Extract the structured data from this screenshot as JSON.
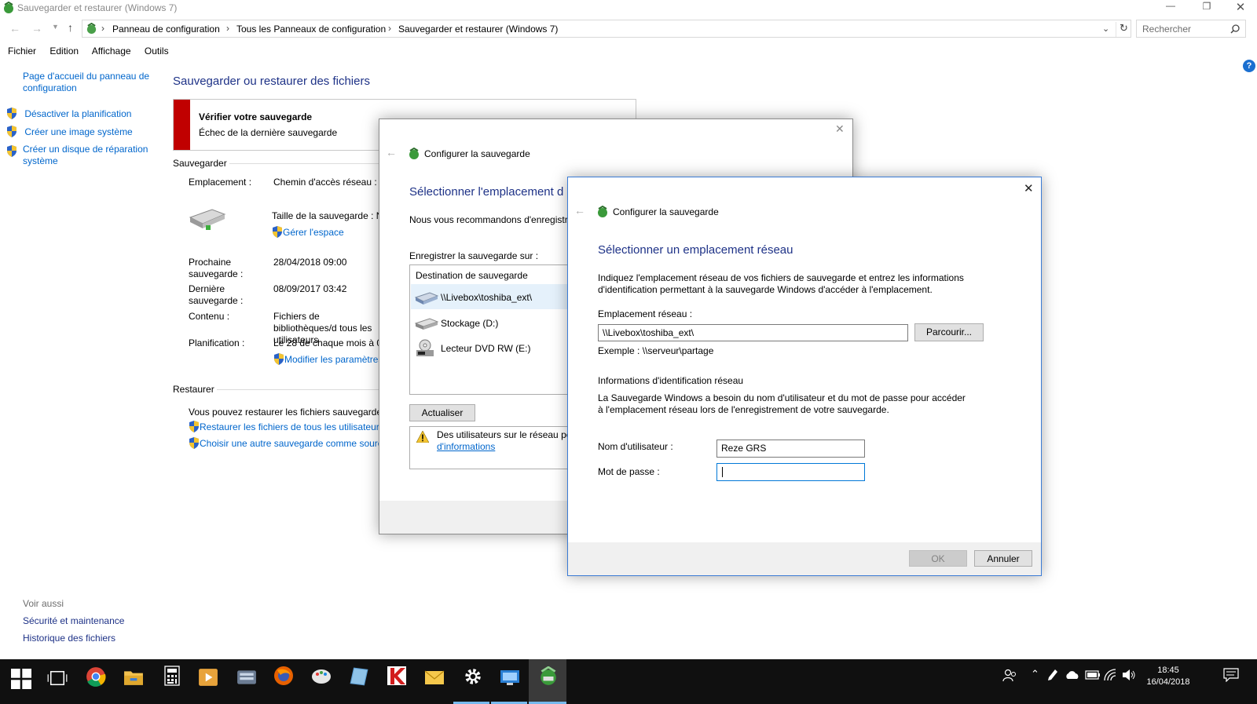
{
  "window": {
    "title": "Sauvegarder et restaurer (Windows 7)"
  },
  "address": {
    "crumbs": [
      "Panneau de configuration",
      "Tous les Panneaux de configuration",
      "Sauvegarder et restaurer (Windows 7)"
    ],
    "search_placeholder": "Rechercher"
  },
  "menu": [
    "Fichier",
    "Edition",
    "Affichage",
    "Outils"
  ],
  "sidebar": {
    "home": "Page d'accueil du panneau de configuration",
    "items": [
      "Désactiver la planification",
      "Créer une image système",
      "Créer un disque de réparation système"
    ],
    "see_also_title": "Voir aussi",
    "see_also": [
      "Sécurité et maintenance",
      "Historique des fichiers"
    ]
  },
  "main": {
    "title": "Sauvegarder ou restaurer des fichiers",
    "alert_title": "Vérifier votre sauvegarde",
    "alert_sub": "Échec de la dernière sauvegarde",
    "backup_section": "Sauvegarder",
    "location_label": "Emplacement :",
    "location_value": "Chemin d'accès réseau : \\\\",
    "size_label": "Taille de la sauvegarde : No",
    "manage_space": "Gérer l'espace",
    "next_label": "Prochaine sauvegarde :",
    "next_value": "28/04/2018 09:00",
    "last_label": "Dernière sauvegarde :",
    "last_value": "08/09/2017 03:42",
    "content_label": "Contenu :",
    "content_value": "Fichiers de bibliothèques/d tous les utilisateurs",
    "schedule_label": "Planification :",
    "schedule_value": "Le 28 de chaque mois à 09",
    "modify_settings": "Modifier les paramètres",
    "restore_section": "Restaurer",
    "restore_text": "Vous pouvez restaurer les fichiers sauvegardés à",
    "restore_all": "Restaurer les fichiers de tous les utilisateurs",
    "choose_other": "Choisir une autre sauvegarde comme source"
  },
  "dialog1": {
    "title": "Configurer la sauvegarde",
    "heading": "Sélectionner l'emplacement d",
    "recommend": "Nous vous recommandons d'enregistre",
    "save_on": "Enregistrer la sauvegarde sur :",
    "list_header": "Destination de sauvegarde",
    "destinations": [
      "\\\\Livebox\\toshiba_ext\\",
      "Stockage (D:)",
      "Lecteur DVD RW (E:)"
    ],
    "refresh": "Actualiser",
    "warning": "Des utilisateurs sur le réseau peu",
    "warning_link": "d'informations"
  },
  "dialog2": {
    "title": "Configurer la sauvegarde",
    "heading": "Sélectionner un emplacement réseau",
    "intro": "Indiquez l'emplacement réseau de vos fichiers de sauvegarde et entrez les informations d'identification permettant à la sauvegarde Windows d'accéder à l'emplacement.",
    "network_label": "Emplacement réseau :",
    "network_value": "\\\\Livebox\\toshiba_ext\\",
    "browse": "Parcourir...",
    "example": "Exemple : \\\\serveur\\partage",
    "creds_title": "Informations d'identification réseau",
    "creds_text": "La Sauvegarde Windows a besoin du nom d'utilisateur et du mot de passe pour accéder à l'emplacement réseau lors de l'enregistrement de votre sauvegarde.",
    "user_label": "Nom d'utilisateur :",
    "user_value": "Reze GRS",
    "pass_label": "Mot de passe :",
    "pass_value": "",
    "ok": "OK",
    "cancel": "Annuler"
  },
  "taskbar": {
    "time": "18:45",
    "date": "16/04/2018"
  },
  "colors": {
    "link": "#0066cc",
    "heading": "#1e3287",
    "alert": "#c00000",
    "taskbar": "#101010"
  }
}
